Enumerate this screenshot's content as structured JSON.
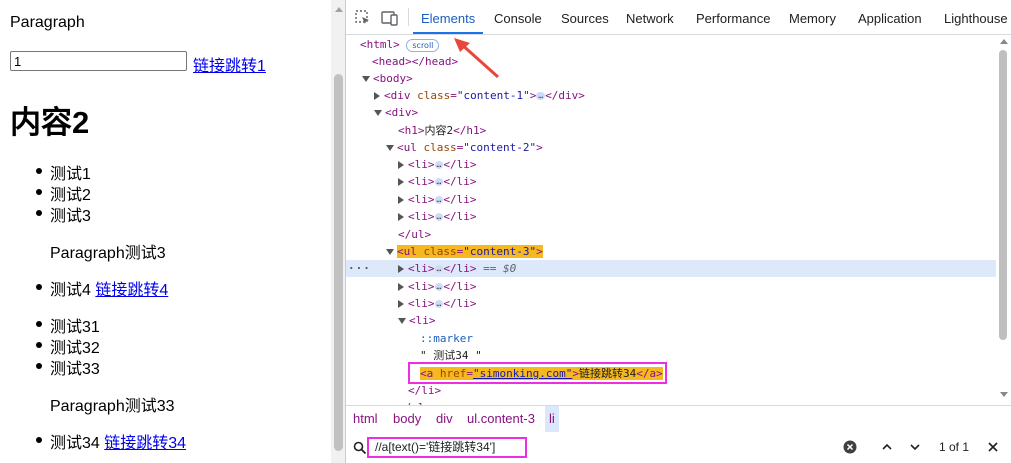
{
  "page": {
    "paragraph1": "Paragraph",
    "input_value": "1",
    "link1": "链接跳转1",
    "heading": "内容2",
    "list1": [
      "测试1",
      "测试2",
      "测试3"
    ],
    "paragraph2": "Paragraph测试3",
    "list2_item_text": "测试4 ",
    "list2_link": "链接跳转4",
    "list3": [
      "测试31",
      "测试32",
      "测试33"
    ],
    "paragraph3": "Paragraph测试33",
    "list4_item_text": "测试34 ",
    "list4_link": "链接跳转34"
  },
  "devtools": {
    "tabs": [
      "Elements",
      "Console",
      "Sources",
      "Network",
      "Performance",
      "Memory",
      "Application",
      "Lighthouse"
    ],
    "active_tab": "Elements",
    "dom": {
      "html": "<html>",
      "scroll_badge": "scroll",
      "head": "<head></head>",
      "body": "<body>",
      "div_content1_attr": "class",
      "div_content1_val": "\"content-1\"",
      "div": "<div>",
      "h1_text": "内容2",
      "ul2_val": "\"content-2\"",
      "ul_close": "</ul>",
      "ul3_val": "\"content-3\"",
      "eq0": "== $0",
      "li_open": "<li>",
      "marker": "::marker",
      "text_node": "\" 测试34 \"",
      "a_href": "\"simonking.com\"",
      "a_text": "链接跳转34",
      "li_close": "</li>",
      "ellipsis": "…"
    },
    "breadcrumbs": [
      "html",
      "body",
      "div",
      "ul.content-3",
      "li"
    ],
    "search": {
      "query": "//a[text()='链接跳转34']",
      "count": "1 of 1"
    },
    "colors": {
      "accent": "#1a73e8",
      "tag": "#881280",
      "attr": "#994500",
      "value": "#1a1aa6",
      "highlight": "#f5b81e",
      "annotation": "#ee2ee0",
      "arrow": "#e8473a"
    }
  }
}
